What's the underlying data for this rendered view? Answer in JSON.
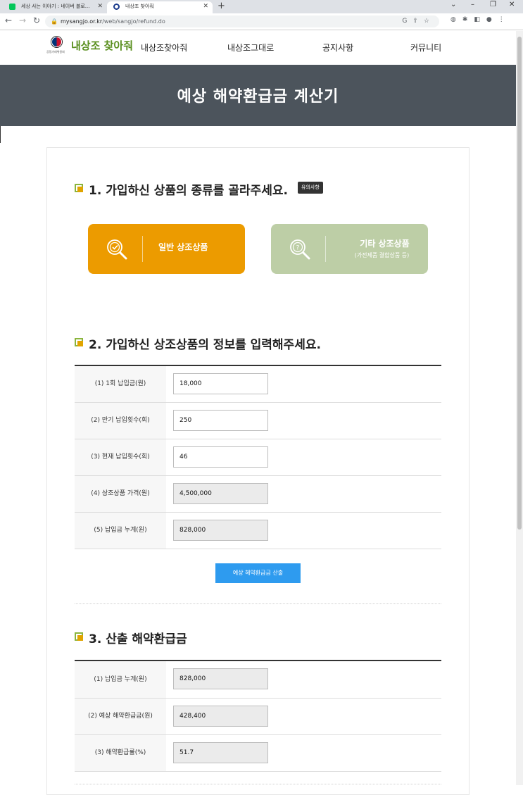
{
  "browser": {
    "tabs": [
      {
        "title": "세상 사는 이야기 : 네이버 블로...",
        "active": false
      },
      {
        "title": "내상조 찾아줘",
        "active": true
      }
    ],
    "new_tab": "+",
    "url_host": "mysangjo.or.kr",
    "url_path": "/web/sangjo/refund.do"
  },
  "site": {
    "logo_text": "내상조 찾아줘",
    "logo_sub": "공정거래위원회",
    "nav": [
      "내상조찾아줘",
      "내상조그대로",
      "공지사항",
      "커뮤니티"
    ]
  },
  "hero": {
    "title": "예상 해약환급금 계산기"
  },
  "section1": {
    "title": "1. 가입하신 상품의 종류를 골라주세요.",
    "notice": "유의사항",
    "products": [
      {
        "label": "일반 상조상품",
        "sub": "",
        "selected": true
      },
      {
        "label": "기타 상조상품",
        "sub": "(가전제품 결합상품 등)",
        "selected": false
      }
    ]
  },
  "section2": {
    "title": "2. 가입하신 상조상품의 정보를 입력해주세요.",
    "rows": [
      {
        "label": "(1) 1회 납입금(원)",
        "value": "18,000",
        "readonly": false
      },
      {
        "label": "(2) 만기 납입횟수(회)",
        "value": "250",
        "readonly": false
      },
      {
        "label": "(3) 현재 납입횟수(회)",
        "value": "46",
        "readonly": false
      },
      {
        "label": "(4) 상조상품 가격(원)",
        "value": "4,500,000",
        "readonly": true
      },
      {
        "label": "(5) 납입금 누계(원)",
        "value": "828,000",
        "readonly": true
      }
    ],
    "calc_button": "예상 해약환급금 산출"
  },
  "section3": {
    "title": "3. 산출 해약환급금",
    "rows": [
      {
        "label": "(1) 납입금 누계(원)",
        "value": "828,000"
      },
      {
        "label": "(2) 예상 해약환급금(원)",
        "value": "428,400"
      },
      {
        "label": "(3) 해약환급률(%)",
        "value": "51.7"
      }
    ]
  },
  "colors": {
    "accent_orange": "#ec9b00",
    "accent_green": "#bdcea6",
    "hero_bg": "#4c545c",
    "button_blue": "#2e9bef",
    "logo_green": "#5a8f1f"
  }
}
